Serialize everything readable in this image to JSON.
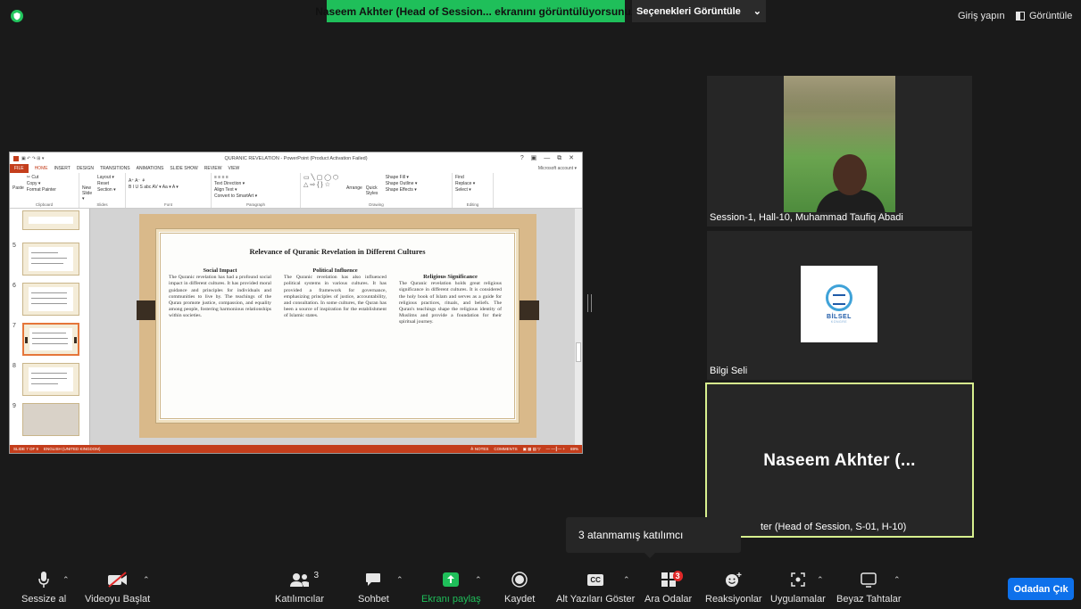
{
  "top": {
    "share_banner": "Naseem Akhter (Head of Session... ekranını görüntülüyorsunuz",
    "view_options": "Seçenekleri Görüntüle",
    "signin": "Giriş yapın",
    "view": "Görüntüle"
  },
  "ppt": {
    "title": "QURANIC REVELATION - PowerPoint (Product Activation Failed)",
    "winctl": "? ▣ — ⧉ ✕",
    "tabs": [
      "FILE",
      "HOME",
      "INSERT",
      "DESIGN",
      "TRANSITIONS",
      "ANIMATIONS",
      "SLIDE SHOW",
      "REVIEW",
      "VIEW"
    ],
    "account": "Microsoft account ▾",
    "ribbon": {
      "clipboard": {
        "name": "Clipboard",
        "items": [
          "✂ Cut",
          "Copy ▾",
          "Format Painter"
        ],
        "paste": "Paste"
      },
      "slides": {
        "name": "Slides",
        "items": [
          "Layout ▾",
          "Reset",
          "Section ▾"
        ],
        "new": "New Slide ▾"
      },
      "font": {
        "name": "Font",
        "items": [
          "A⁺ A⁻ ⚘",
          "B I U S abc AV ▾ Aa ▾ A ▾"
        ]
      },
      "paragraph": {
        "name": "Paragraph",
        "items": [
          "≡ ≡ ≡ ≡",
          "Text Direction ▾",
          "Align Text ▾",
          "Convert to SmartArt ▾"
        ]
      },
      "drawing": {
        "name": "Drawing",
        "items": [
          "Shape Fill ▾",
          "Shape Outline ▾",
          "Shape Effects ▾"
        ],
        "arrange": "Arrange",
        "quick": "Quick Styles"
      },
      "editing": {
        "name": "Editing",
        "items": [
          "Find",
          "Replace ▾",
          "Select ▾"
        ]
      }
    },
    "thumb_numbers": [
      "5",
      "6",
      "7",
      "8",
      "9"
    ],
    "slide": {
      "title": "Relevance of Quranic Revelation in Different Cultures",
      "columns": [
        {
          "heading": "Social Impact",
          "body": "The Quranic revelation has had a profound social impact in different cultures. It has provided moral guidance and principles for individuals and communities to live by. The teachings of the Quran promote justice, compassion, and equality among people, fostering harmonious relationships within societies."
        },
        {
          "heading": "Political Influence",
          "body": "The Quranic revelation has also influenced political systems in various cultures. It has provided a framework for governance, emphasizing principles of justice, accountability, and consultation. In some cultures, the Quran has been a source of inspiration for the establishment of Islamic states."
        },
        {
          "heading": "Religious Significance",
          "body": "The Quranic revelation holds great religious significance in different cultures. It is considered the holy book of Islam and serves as a guide for religious practices, rituals, and beliefs. The Quran's teachings shape the religious identity of Muslims and provide a foundation for their spiritual journey."
        }
      ]
    },
    "status_left": "SLIDE 7 OF 9",
    "status_lang": "ENGLISH (UNITED KINGDOM)",
    "status_notes": "≜ NOTES",
    "status_comments": "COMMENTS",
    "status_zoom": "69%"
  },
  "tiles": {
    "t1": "Session-1, Hall-10, Muhammad Taufiq Abadi",
    "t2": "Bilgi Seli",
    "t2_logo": "BİLSEL",
    "t2_logo_sub": "KONGRE",
    "t3_big": "Naseem Akhter (...",
    "t3_label": "ter (Head of Session, S-01, H-10)"
  },
  "tooltip": "3 atanmamış katılımcı",
  "toolbar": {
    "mute": "Sessize al",
    "video": "Videoyu Başlat",
    "participants": "Katılımcılar",
    "participants_count": "3",
    "chat": "Sohbet",
    "share": "Ekranı paylaş",
    "record": "Kaydet",
    "captions": "Alt Yazıları Göster",
    "cc": "CC",
    "breakout": "Ara Odalar",
    "breakout_badge": "3",
    "reactions": "Reaksiyonlar",
    "apps": "Uygulamalar",
    "whiteboard": "Beyaz Tahtalar",
    "leave": "Odadan Çık"
  },
  "colors": {
    "share_green": "#1fbf5a",
    "leave_blue": "#0e71eb",
    "speaker_border": "#d7ef8e",
    "ppt_accent": "#c43e1c"
  }
}
